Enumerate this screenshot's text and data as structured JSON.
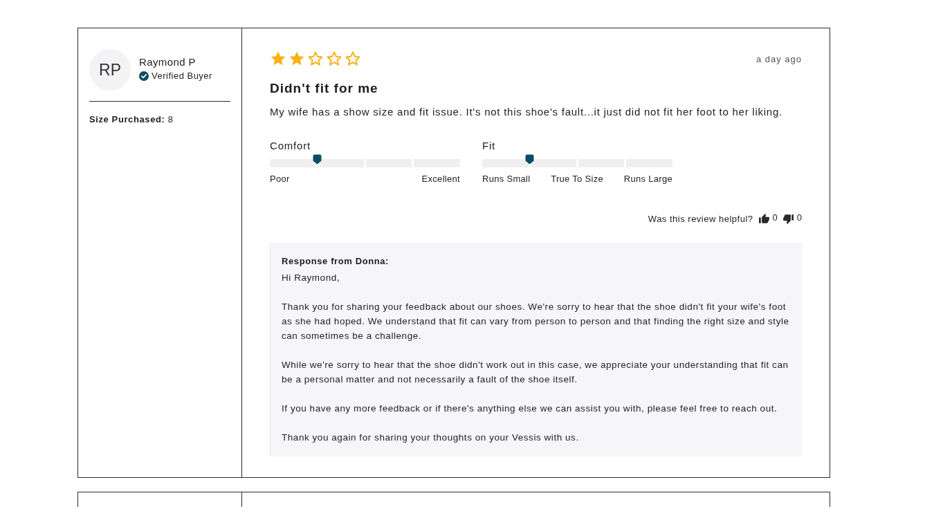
{
  "reviewer": {
    "initials": "RP",
    "name": "Raymond P",
    "badge": "Verified Buyer",
    "details": [
      "**Size Purchased:** 8"
    ]
  },
  "review": {
    "stars": 2,
    "date": "a day ago",
    "title": "Didn't fit for me",
    "body": "My wife has a show size and fit issue. It's not this shoe's fault...it just did not fit her foot to her liking."
  },
  "ratings": [
    {
      "label": "Comfort",
      "level": 0.25,
      "scale": [
        "Poor",
        "Excellent"
      ]
    },
    {
      "label": "Fit",
      "level": 0.25,
      "scale": [
        "Runs Small",
        "True To Size",
        "Runs Large"
      ]
    }
  ],
  "helpful": {
    "question": "Was this review helpful?",
    "up_count": "0",
    "down_count": "0"
  },
  "response": {
    "heading": "Response from Donna:",
    "greeting": "Hi Raymond,",
    "paragraphs": [
      "Thank you for sharing your feedback about our shoes. We're sorry to hear that the shoe didn't fit your wife's foot as she had hoped. We understand that fit can vary from person to person and that finding the right size and style can sometimes be a challenge.",
      "While we're sorry to hear that the shoe didn't work out in this case, we appreciate your understanding that fit can be a personal matter and not necessarily a fault of the shoe itself.",
      "If you have any more feedback or if there's anything else we can assist you with, please feel free to reach out.",
      "Thank you again for sharing your thoughts on your Vessis with us."
    ]
  }
}
